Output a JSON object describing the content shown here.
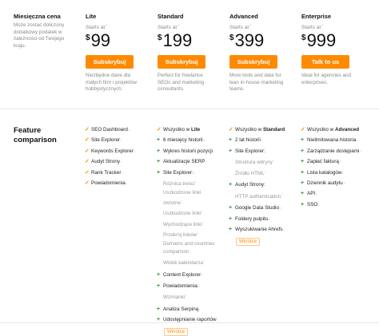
{
  "intro": {
    "title": "Miesięczna cena",
    "text": "Może zostać doliczony dodatkowy podatek w zależności od Twojego kraju."
  },
  "plans": [
    {
      "name": "Lite",
      "starts": "Starts at",
      "currency": "$",
      "price": "99",
      "button": "Subskrybuj",
      "desc": "Niezbędne dane dla małych firm i projektów hobbystycznych."
    },
    {
      "name": "Standard",
      "starts": "Starts at",
      "currency": "$",
      "price": "199",
      "button": "Subskrybuj",
      "desc": "Perfect for freelance SEOs and marketing consultants."
    },
    {
      "name": "Advanced",
      "starts": "Starts at",
      "currency": "$",
      "price": "399",
      "button": "Subskrybuj",
      "desc": "More tools and data for lean in-house marketing teams."
    },
    {
      "name": "Enterprise",
      "starts": "Starts at",
      "currency": "$",
      "price": "999",
      "button": "Talk to us",
      "desc": "Ideal for agencies and enterprises."
    }
  ],
  "feature_comparison": {
    "title_line1": "Feature",
    "title_line2": "comparison",
    "lite": [
      "SEO Dashboard",
      "Site Explorer",
      "Keywords Explorer",
      "Audyt Strony",
      "Rank Tracker",
      "Powiadomienia"
    ],
    "standard": {
      "header_prefix": "Wszystko w",
      "header_plan": "Lite",
      "items_a": [
        "6 miesięcy historii",
        "Wykres historii pozycji",
        "Aktualizacje SERP",
        "Site Explorer:"
      ],
      "sub_site_explorer": [
        "Różnica treści",
        "Uszkodzone linki zwrotne",
        "Uszkodzone linki",
        "Wychodzące linki",
        "Przekroj linków",
        "Domains and countries comparison",
        "Widok kalendarza"
      ],
      "items_b": [
        "Content Explorer",
        "Powiadomienia:"
      ],
      "sub_powiadomienia": [
        "Wzmianki"
      ],
      "items_c": [
        "Analiza Serpiną",
        "Udostępnianie raportów"
      ],
      "tag": "Wkrótce"
    },
    "advanced": {
      "header_prefix": "Wszystko w",
      "header_plan": "Standard",
      "items_a": [
        "2 lat historii",
        "Site Explorer:"
      ],
      "sub_site_explorer": [
        "Struktura witryny",
        "Źródło HTML"
      ],
      "items_b": [
        "Audyt Strony:"
      ],
      "sub_audyt": [
        "HTTP authentication"
      ],
      "items_c": [
        "Google Data Studio",
        "Foldery pulpitu",
        "Wyszukiwanie Ahrefs"
      ],
      "tag": "Wkrótce"
    },
    "enterprise": {
      "header_prefix": "Wszystko w",
      "header_plan": "Advanced",
      "items": [
        "Nielimitowana historia",
        "Zarządzanie dostępami",
        "Zapłać fakturą",
        "Lista katalogów",
        "Dziennik audytu",
        "API",
        "SSO"
      ]
    }
  },
  "colors": {
    "accent": "#ff8a00",
    "plus": "#2a9a3a",
    "muted": "#8a8a8a"
  }
}
